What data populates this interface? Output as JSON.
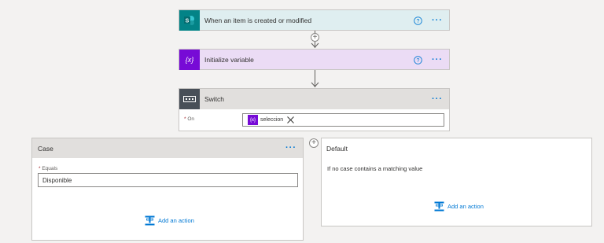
{
  "trigger": {
    "title": "When an item is created or modified",
    "icon": "sharepoint-icon",
    "color": "#038387",
    "header_bg": "#dfeef0"
  },
  "init_var": {
    "title": "Initialize variable",
    "icon": "variable-icon",
    "icon_text": "{x}",
    "color": "#770bd6",
    "header_bg": "#ebdcf5"
  },
  "switch": {
    "title": "Switch",
    "icon": "switch-icon",
    "color": "#484f58",
    "on_label": "On",
    "token_icon_text": "{x}",
    "token_label": "seleccion"
  },
  "case_block": {
    "title": "Case",
    "equals_label": "Equals",
    "equals_value": "Disponible",
    "add_action": "Add an action"
  },
  "default_block": {
    "title": "Default",
    "description": "If no case contains a matching value",
    "add_action": "Add an action"
  },
  "more_glyph": "···",
  "required_marker": "*",
  "accent": "#0078d4"
}
